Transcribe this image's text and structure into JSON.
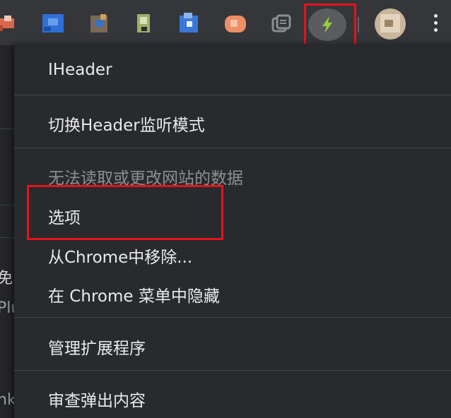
{
  "toolbar": {
    "active_extension_icon": "lightning-bolt-icon",
    "more_icon": "vertical-dots-icon",
    "accent_red": "#e3141a"
  },
  "menu": {
    "items": [
      {
        "label": "IHeader",
        "enabled": true
      },
      {
        "label": "切换Header监听模式",
        "enabled": true
      },
      {
        "label": "无法读取或更改网站的数据",
        "enabled": false
      },
      {
        "label": "选项",
        "enabled": true
      },
      {
        "label": "从Chrome中移除...",
        "enabled": true
      },
      {
        "label": "在 Chrome 菜单中隐藏",
        "enabled": true
      },
      {
        "label": "管理扩展程序",
        "enabled": true
      },
      {
        "label": "审查弹出内容",
        "enabled": true
      }
    ]
  },
  "background_page": {
    "fragments": [
      "免",
      "Plu",
      "nk"
    ]
  }
}
